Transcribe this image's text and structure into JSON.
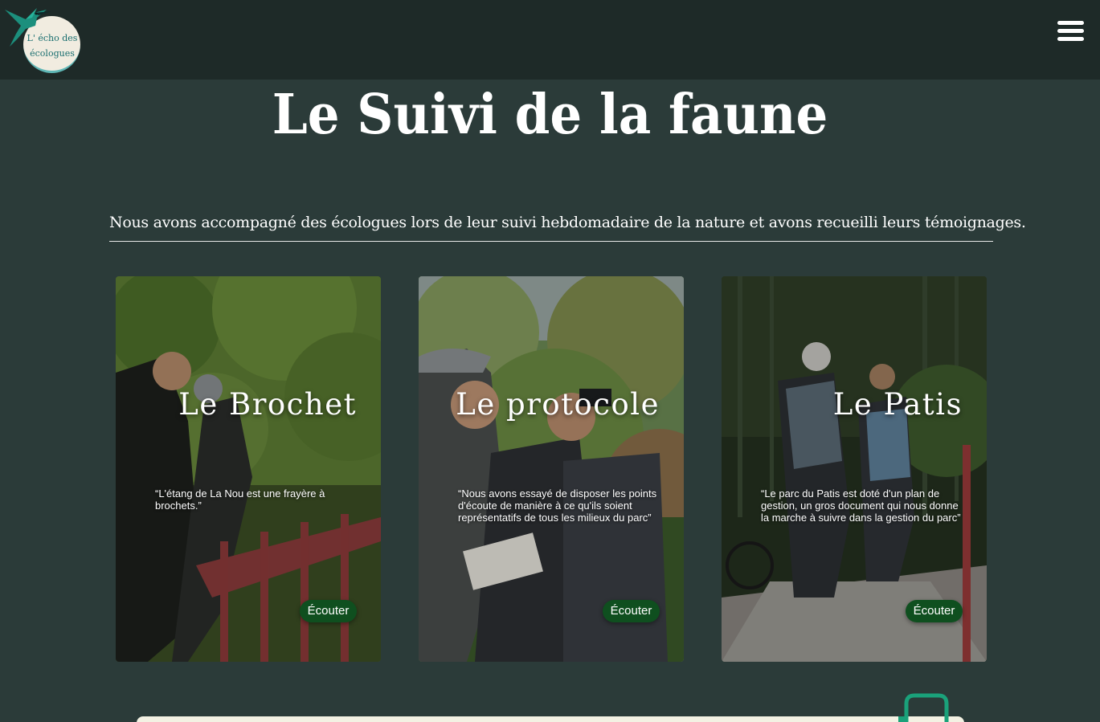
{
  "header": {
    "logo_text": "L' écho des écologues",
    "logo_line1": "L' écho des",
    "logo_line2": "écologues",
    "menu_icon": "hamburger-icon"
  },
  "page": {
    "title": "Le Suivi de la faune",
    "intro": "Nous avons accompagné des écologues lors de leur suivi hebdomadaire de la nature et avons recueilli leurs témoignages."
  },
  "cards": [
    {
      "title": "Le Brochet",
      "quote": "“L'étang de La Nou est une frayère à brochets.”",
      "button": "Écouter"
    },
    {
      "title": "Le protocole",
      "quote": "“Nous avons essayé de disposer les points d'écoute de manière à ce qu'ils soient représentatifs de tous les milieux du parc”",
      "button": "Écouter"
    },
    {
      "title": "Le Patis",
      "quote": "“Le parc du Patis est doté d'un plan de gestion, un gros document qui nous donne la marche à suivre dans la gestion du parc”",
      "button": "Écouter"
    }
  ],
  "colors": {
    "background": "#2b3b39",
    "header": "#1e2a28",
    "button": "#0f4f1f",
    "accent": "#1aa17a"
  },
  "icons": [
    "hummingbird-icon",
    "hamburger-icon",
    "bag-icon"
  ]
}
